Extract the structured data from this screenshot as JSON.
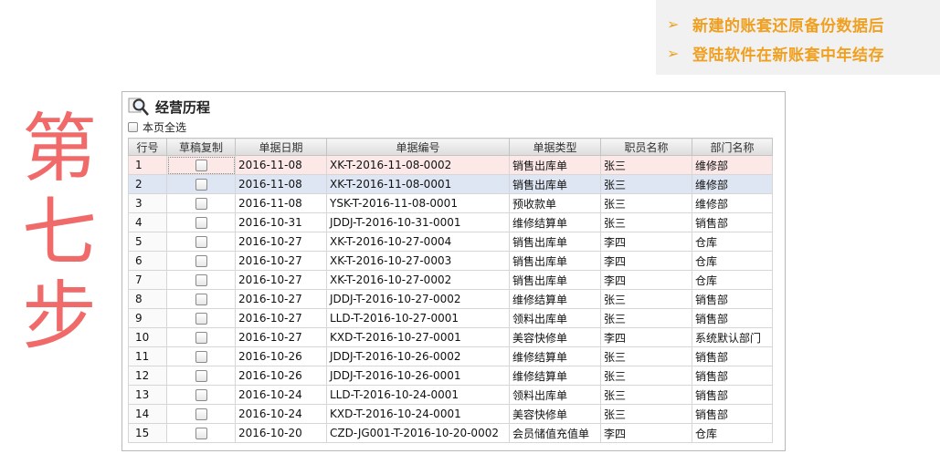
{
  "notes": [
    {
      "arrow": "➢",
      "text": "新建的账套还原备份数据后"
    },
    {
      "arrow": "➢",
      "text": "登陆软件在新账套中年结存"
    }
  ],
  "step_title": [
    "第",
    "七",
    "步"
  ],
  "panel": {
    "title": "经营历程",
    "select_all_label": "本页全选",
    "columns": [
      "行号",
      "草稿复制",
      "单据日期",
      "单据编号",
      "单据类型",
      "职员名称",
      "部门名称"
    ],
    "rows": [
      {
        "no": "1",
        "date": "2016-11-08",
        "code": "XK-T-2016-11-08-0002",
        "type": "销售出库单",
        "staff": "张三",
        "dept": "维修部"
      },
      {
        "no": "2",
        "date": "2016-11-08",
        "code": "XK-T-2016-11-08-0001",
        "type": "销售出库单",
        "staff": "张三",
        "dept": "维修部"
      },
      {
        "no": "3",
        "date": "2016-11-08",
        "code": "YSK-T-2016-11-08-0001",
        "type": "预收款单",
        "staff": "张三",
        "dept": "维修部"
      },
      {
        "no": "4",
        "date": "2016-10-31",
        "code": "JDDJ-T-2016-10-31-0001",
        "type": "维修结算单",
        "staff": "张三",
        "dept": "销售部"
      },
      {
        "no": "5",
        "date": "2016-10-27",
        "code": "XK-T-2016-10-27-0004",
        "type": "销售出库单",
        "staff": "李四",
        "dept": "仓库"
      },
      {
        "no": "6",
        "date": "2016-10-27",
        "code": "XK-T-2016-10-27-0003",
        "type": "销售出库单",
        "staff": "李四",
        "dept": "仓库"
      },
      {
        "no": "7",
        "date": "2016-10-27",
        "code": "XK-T-2016-10-27-0002",
        "type": "销售出库单",
        "staff": "李四",
        "dept": "仓库"
      },
      {
        "no": "8",
        "date": "2016-10-27",
        "code": "JDDJ-T-2016-10-27-0002",
        "type": "维修结算单",
        "staff": "张三",
        "dept": "销售部"
      },
      {
        "no": "9",
        "date": "2016-10-27",
        "code": "LLD-T-2016-10-27-0001",
        "type": "领料出库单",
        "staff": "张三",
        "dept": "销售部"
      },
      {
        "no": "10",
        "date": "2016-10-27",
        "code": "KXD-T-2016-10-27-0001",
        "type": "美容快修单",
        "staff": "李四",
        "dept": "系统默认部门"
      },
      {
        "no": "11",
        "date": "2016-10-26",
        "code": "JDDJ-T-2016-10-26-0002",
        "type": "维修结算单",
        "staff": "张三",
        "dept": "销售部"
      },
      {
        "no": "12",
        "date": "2016-10-26",
        "code": "JDDJ-T-2016-10-26-0001",
        "type": "维修结算单",
        "staff": "张三",
        "dept": "销售部"
      },
      {
        "no": "13",
        "date": "2016-10-24",
        "code": "LLD-T-2016-10-24-0001",
        "type": "领料出库单",
        "staff": "张三",
        "dept": "销售部"
      },
      {
        "no": "14",
        "date": "2016-10-24",
        "code": "KXD-T-2016-10-24-0001",
        "type": "美容快修单",
        "staff": "张三",
        "dept": "销售部"
      },
      {
        "no": "15",
        "date": "2016-10-20",
        "code": "CZD-JG001-T-2016-10-20-0002",
        "type": "会员储值充值单",
        "staff": "李四",
        "dept": "仓库"
      }
    ]
  },
  "colors": {
    "note_text": "#f0a020",
    "step_title": "#f06a6a",
    "row_selected_1": "#fde8e8",
    "row_selected_2": "#dde6f2"
  },
  "icons": {
    "panel": "magnifier-icon"
  }
}
